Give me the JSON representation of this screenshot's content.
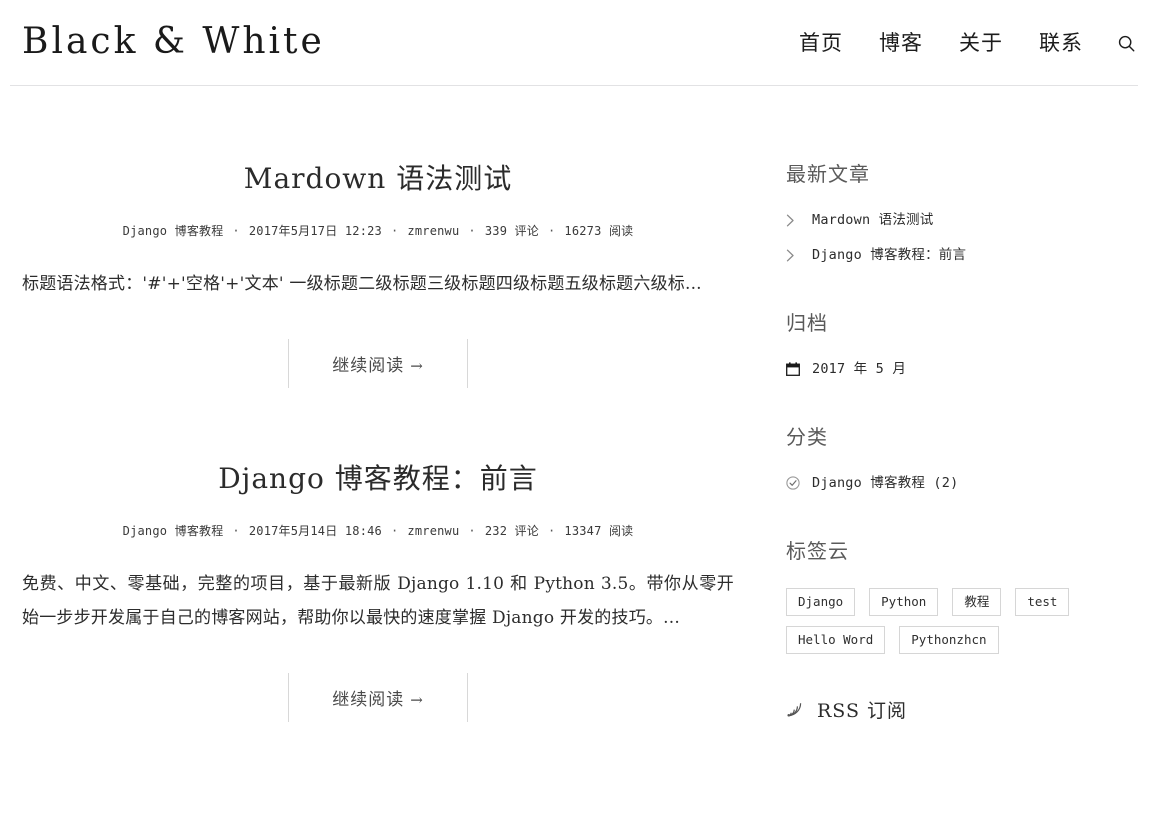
{
  "header": {
    "site_title": "Black & White",
    "nav": [
      {
        "label": "首页",
        "name": "nav-home"
      },
      {
        "label": "博客",
        "name": "nav-blog"
      },
      {
        "label": "关于",
        "name": "nav-about"
      },
      {
        "label": "联系",
        "name": "nav-contact"
      }
    ],
    "search_icon": "search-icon"
  },
  "posts": [
    {
      "title": "Mardown 语法测试",
      "category": "Django 博客教程",
      "date": "2017年5月17日 12:23",
      "author": "zmrenwu",
      "comments": "339 评论",
      "views": "16273 阅读",
      "excerpt": "标题语法格式：'#'+'空格'+'文本' 一级标题二级标题三级标题四级标题五级标题六级标...",
      "readmore": "继续阅读",
      "readmore_arrow": "→"
    },
    {
      "title": "Django 博客教程：前言",
      "category": "Django 博客教程",
      "date": "2017年5月14日 18:46",
      "author": "zmrenwu",
      "comments": "232 评论",
      "views": "13347 阅读",
      "excerpt": "免费、中文、零基础，完整的项目，基于最新版 Django 1.10 和 Python 3.5。带你从零开始一步步开发属于自己的博客网站，帮助你以最快的速度掌握 Django 开发的技巧。...",
      "readmore": "继续阅读",
      "readmore_arrow": "→"
    }
  ],
  "meta_separator": "·",
  "sidebar": {
    "recent": {
      "title": "最新文章",
      "items": [
        {
          "label": "Mardown 语法测试",
          "icon": "chevron-right-icon"
        },
        {
          "label": "Django 博客教程：前言",
          "icon": "chevron-right-icon"
        }
      ]
    },
    "archives": {
      "title": "归档",
      "items": [
        {
          "label": "2017 年 5 月",
          "icon": "calendar-icon"
        }
      ]
    },
    "categories": {
      "title": "分类",
      "items": [
        {
          "label": "Django 博客教程 (2)",
          "icon": "check-circle-icon"
        }
      ]
    },
    "tagcloud": {
      "title": "标签云",
      "tags": [
        "Django",
        "Python",
        "教程",
        "test",
        "Hello Word",
        "Pythonzhcn"
      ]
    },
    "rss": {
      "label": "RSS 订阅",
      "icon": "rss-icon"
    }
  },
  "colors": {
    "text": "#2c2c2c",
    "muted": "#5a5a5a",
    "border": "#d6d6d6",
    "header_border": "#e2e2e4"
  }
}
